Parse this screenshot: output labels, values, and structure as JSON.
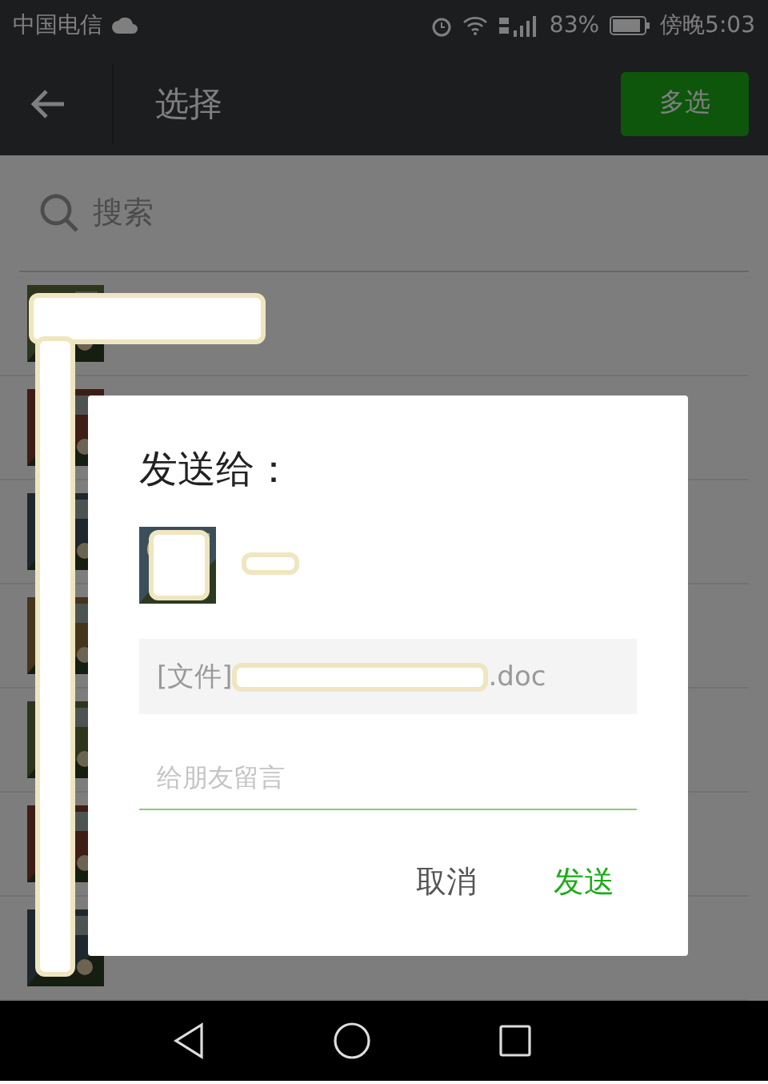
{
  "status_bar": {
    "carrier": "中国电信",
    "battery": "83%",
    "time": "傍晚5:03"
  },
  "header": {
    "title": "选择",
    "action": "多选"
  },
  "search": {
    "placeholder": "搜索"
  },
  "dialog": {
    "title": "发送给：",
    "file": {
      "prefix": "[文件]",
      "suffix": ".doc"
    },
    "message": {
      "placeholder": "给朋友留言"
    },
    "buttons": [
      {
        "label": "取消",
        "kind": "cancel"
      },
      {
        "label": "发送",
        "kind": "primary"
      }
    ]
  }
}
